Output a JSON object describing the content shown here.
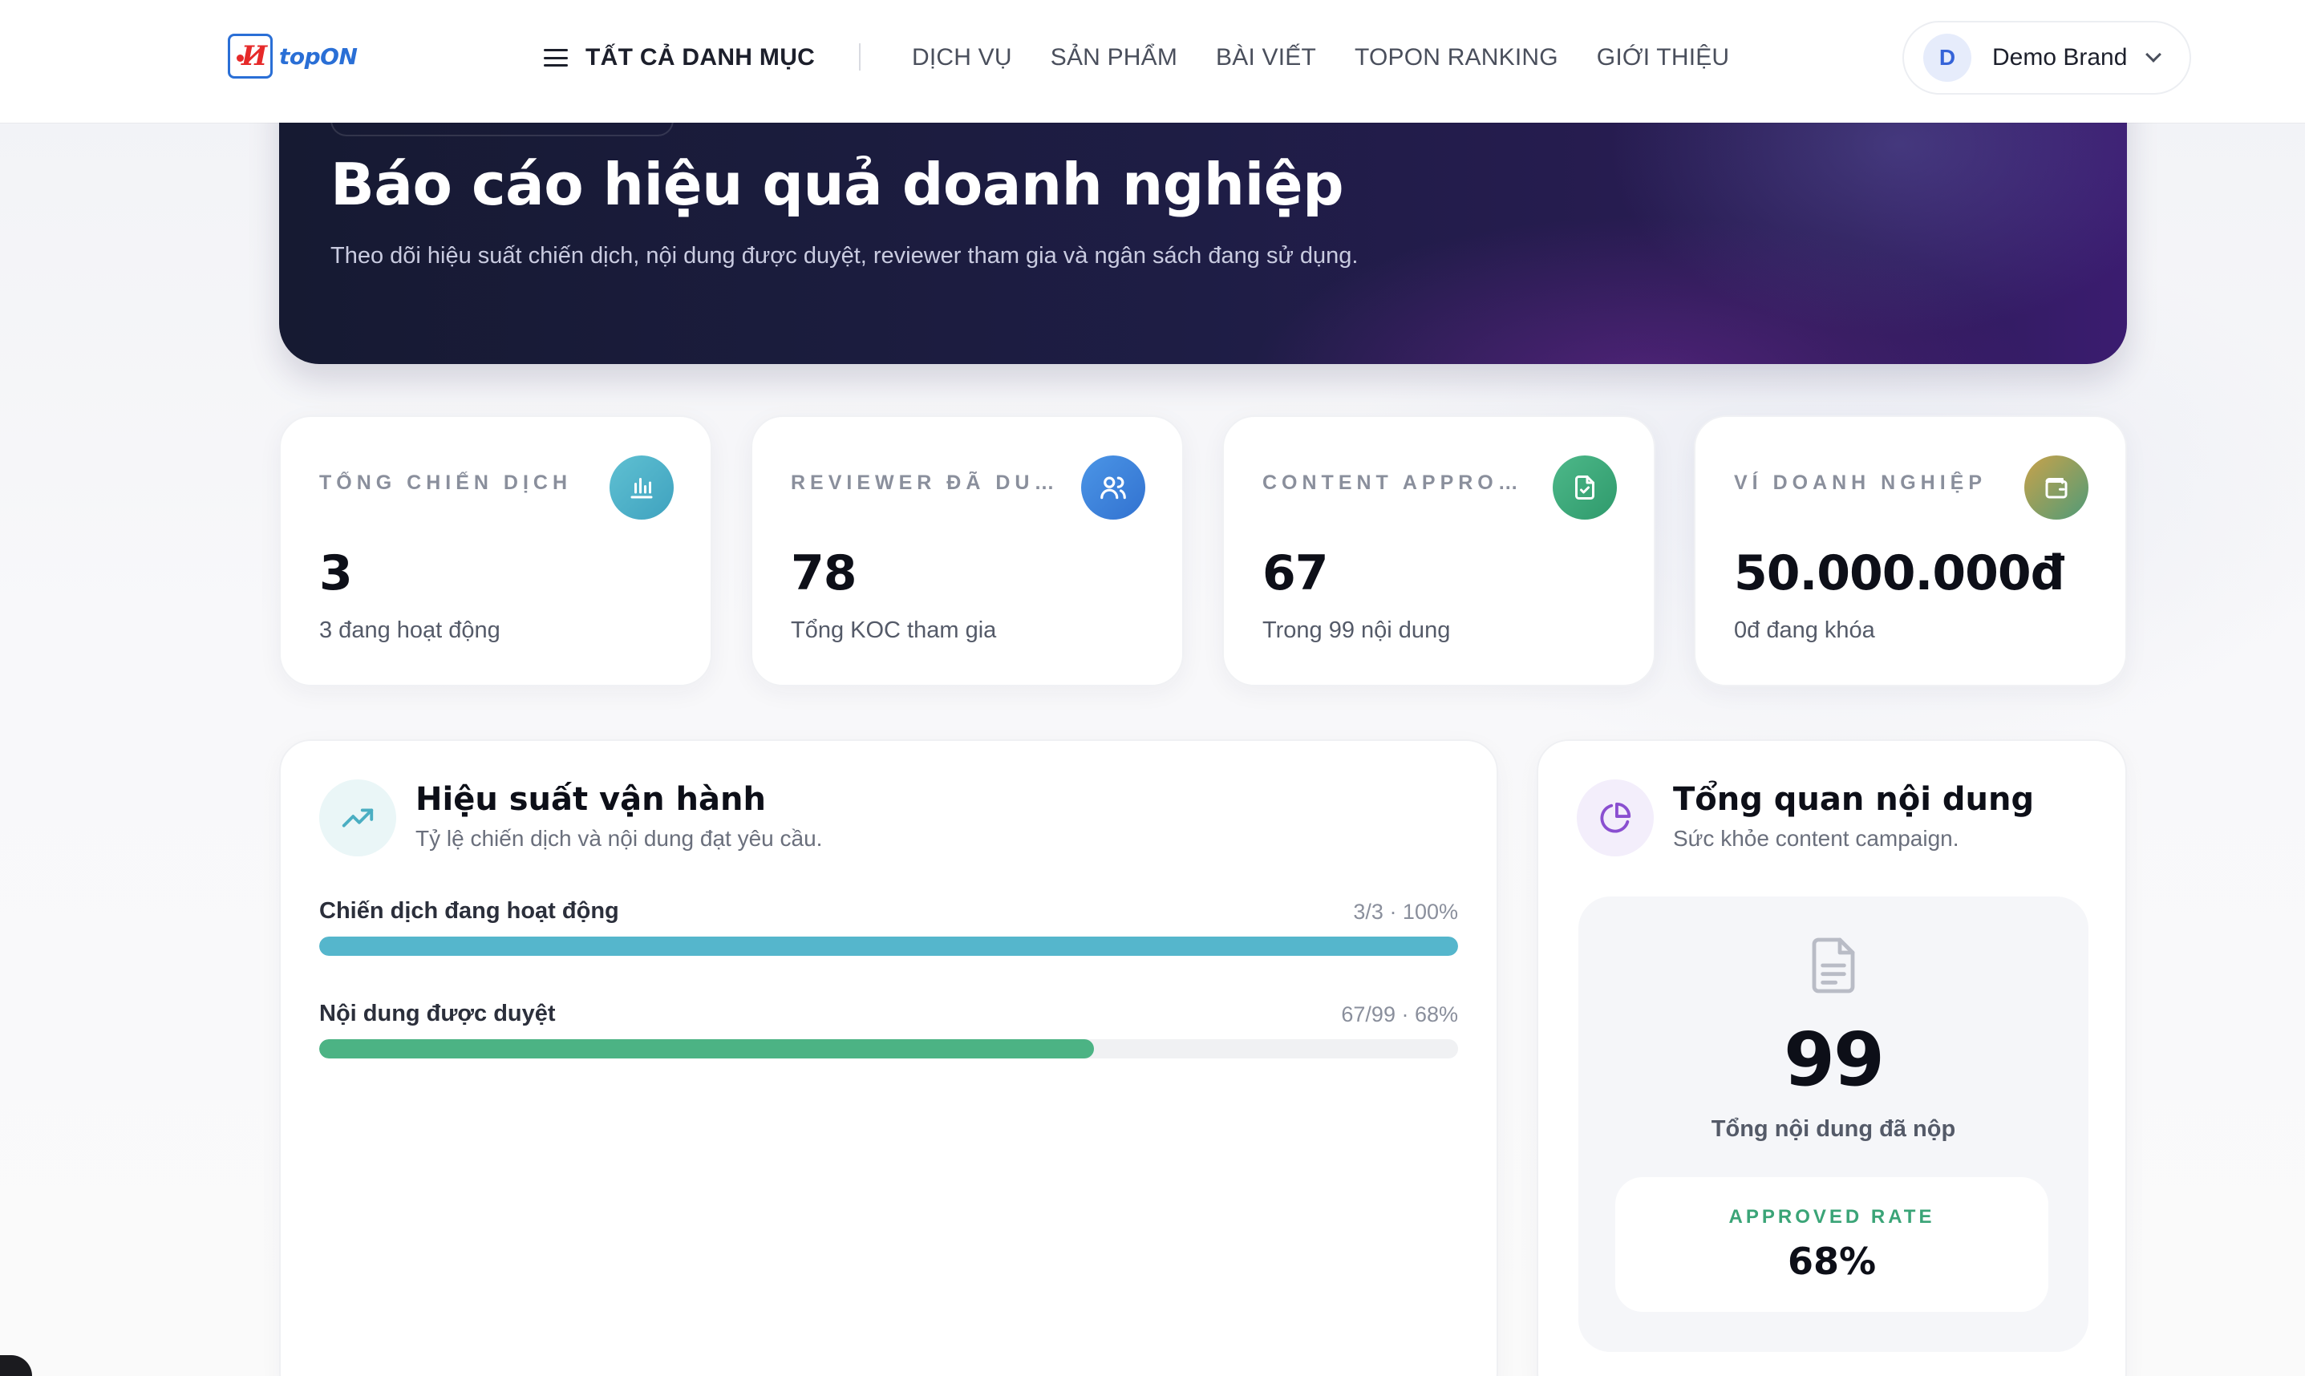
{
  "header": {
    "logo_text": "topON",
    "menu_all_label": "TẤT CẢ DANH MỤC",
    "nav": [
      "DỊCH VỤ",
      "SẢN PHẨM",
      "BÀI VIẾT",
      "TOPON RANKING",
      "GIỚI THIỆU"
    ],
    "user": {
      "initial": "D",
      "name": "Demo Brand"
    }
  },
  "hero": {
    "title": "Báo cáo hiệu quả doanh nghiệp",
    "subtitle": "Theo dõi hiệu suất chiến dịch, nội dung được duyệt, reviewer tham gia và ngân sách đang sử dụng."
  },
  "stats": [
    {
      "label": "TỔNG CHIẾN DỊCH",
      "value": "3",
      "sub": "3 đang hoạt động",
      "icon": "bar-chart-icon",
      "color": "#4fb3c9"
    },
    {
      "label": "REVIEWER ĐÃ DUYỆT",
      "value": "78",
      "sub": "Tổng KOC tham gia",
      "icon": "users-icon",
      "color": "#3f87dc"
    },
    {
      "label": "CONTENT APPROVED",
      "value": "67",
      "sub": "Trong 99 nội dung",
      "icon": "file-check-icon",
      "color": "#3ea57a"
    },
    {
      "label": "VÍ DOANH NGHIỆP",
      "value": "50.000.000đ",
      "sub": "0đ đang khóa",
      "icon": "wallet-icon",
      "color": "#8a9a48"
    }
  ],
  "performance": {
    "title": "Hiệu suất vận hành",
    "subtitle": "Tỷ lệ chiến dịch và nội dung đạt yêu cầu.",
    "icon": "trending-up-icon",
    "bars": [
      {
        "label": "Chiến dịch đang hoạt động",
        "meta": "3/3 · 100%",
        "percent": 100,
        "color": "#55b6cc"
      },
      {
        "label": "Nội dung được duyệt",
        "meta": "67/99 · 68%",
        "percent": 68,
        "color": "#4cb384"
      }
    ]
  },
  "overview": {
    "title": "Tổng quan nội dung",
    "subtitle": "Sức khỏe content campaign.",
    "icon": "pie-chart-icon",
    "total_value": "99",
    "total_caption": "Tổng nội dung đã nộp",
    "rate_label": "APPROVED RATE",
    "rate_value": "68%"
  }
}
